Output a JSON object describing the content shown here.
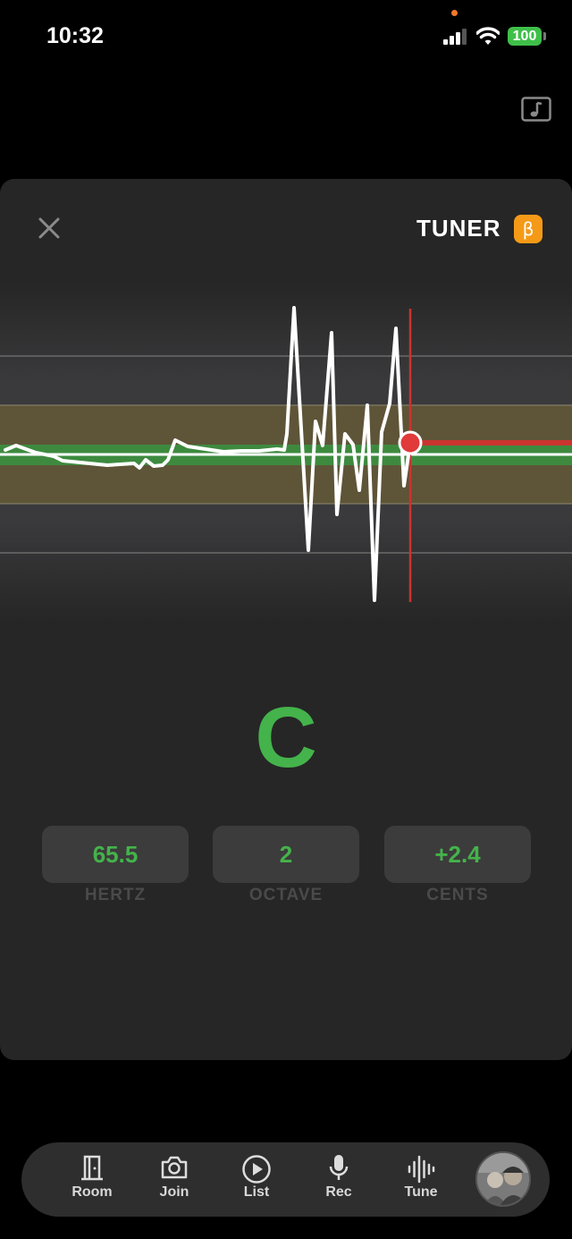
{
  "status": {
    "time": "10:32",
    "battery": "100"
  },
  "tuner": {
    "title": "TUNER",
    "beta": "β",
    "note": "C",
    "readouts": [
      {
        "value": "65.5",
        "label": "HERTZ"
      },
      {
        "value": "2",
        "label": "OCTAVE"
      },
      {
        "value": "+2.4",
        "label": "CENTS"
      }
    ]
  },
  "colors": {
    "accent_green": "#44b34b",
    "marker_red": "#e03a3a",
    "beta_orange": "#f59a17",
    "band_yellow": "#5e5437"
  },
  "nav": {
    "items": [
      {
        "label": "Room",
        "icon": "door-icon"
      },
      {
        "label": "Join",
        "icon": "camera-icon"
      },
      {
        "label": "List",
        "icon": "play-circle-icon"
      },
      {
        "label": "Rec",
        "icon": "microphone-icon"
      },
      {
        "label": "Tune",
        "icon": "waveform-icon"
      }
    ],
    "avatar": "avatar"
  }
}
